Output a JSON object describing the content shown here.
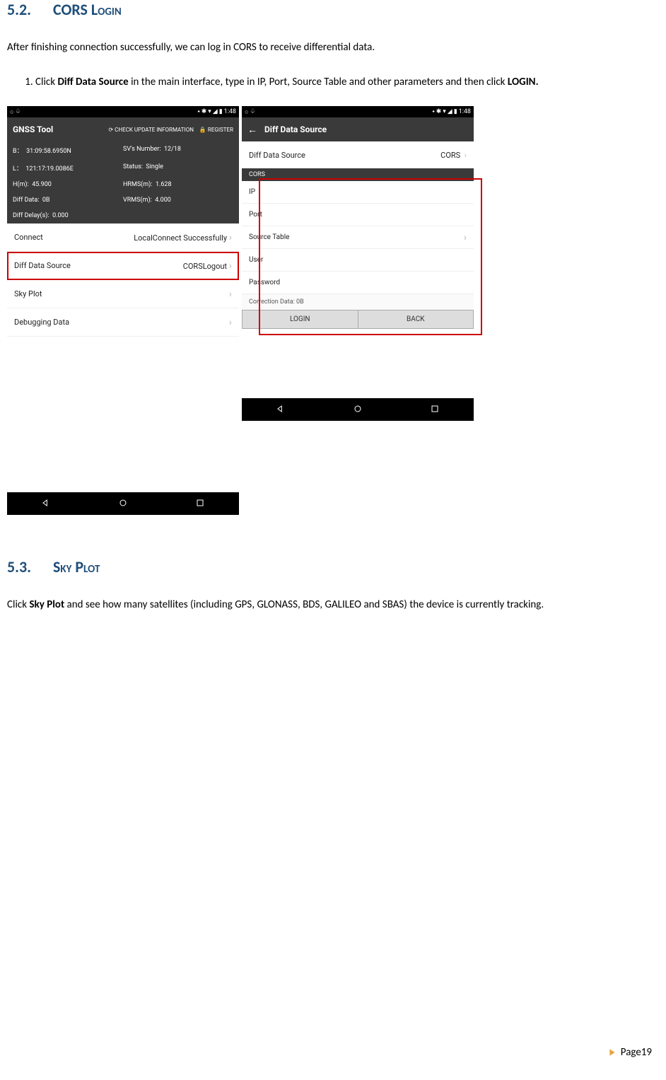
{
  "section52": {
    "num": "5.2.",
    "title": "CORS Login"
  },
  "intro52": "After finishing connection successfully, we can log in CORS to receive differential data.",
  "step1_pre": "Click ",
  "step1_bold1": "Diff Data Source",
  "step1_mid": " in the main interface, type in IP, Port, Source Table and other parameters and then click ",
  "step1_bold2": "LOGIN.",
  "status_time": "1:48",
  "phone1": {
    "appbar_title": "GNSS Tool",
    "check_update": "CHECK UPDATE INFORMATION",
    "register": "REGISTER",
    "info": {
      "b_label": "B：",
      "b_val": "31:09:58.6950N",
      "sv_label": "SV's Number:",
      "sv_val": "12/18",
      "l_label": "L：",
      "l_val": "121:17:19.0086E",
      "status_label": "Status:",
      "status_val": "Single",
      "h_label": "H(m):",
      "h_val": "45.900",
      "hrms_label": "HRMS(m):",
      "hrms_val": "1.628",
      "dd_label": "Diff Data:",
      "dd_val": "0B",
      "vrms_label": "VRMS(m):",
      "vrms_val": "4.000",
      "delay_label": "Diff Delay(s):",
      "delay_val": "0.000"
    },
    "rows": {
      "connect": "Connect",
      "connect_val": "LocalConnect Successfully",
      "dds": "Diff Data Source",
      "dds_val": "CORSLogout",
      "sky": "Sky Plot",
      "debug": "Debugging Data"
    }
  },
  "phone2": {
    "appbar_title": "Diff Data Source",
    "dds_label": "Diff Data Source",
    "dds_val": "CORS",
    "cors_hdr": "CORS",
    "ip": "IP",
    "port": "Port",
    "src": "Source Table",
    "user": "User",
    "pwd": "Password",
    "corr": "Correction Data:   0B",
    "login": "LOGIN",
    "back": "BACK"
  },
  "section53": {
    "num": "5.3.",
    "title": "Sky Plot"
  },
  "para53_pre": "Click ",
  "para53_bold": "Sky Plot",
  "para53_post": " and see how many satellites (including GPS, GLONASS, BDS, GALILEO and SBAS) the device is currently tracking.",
  "footer": "Page19"
}
